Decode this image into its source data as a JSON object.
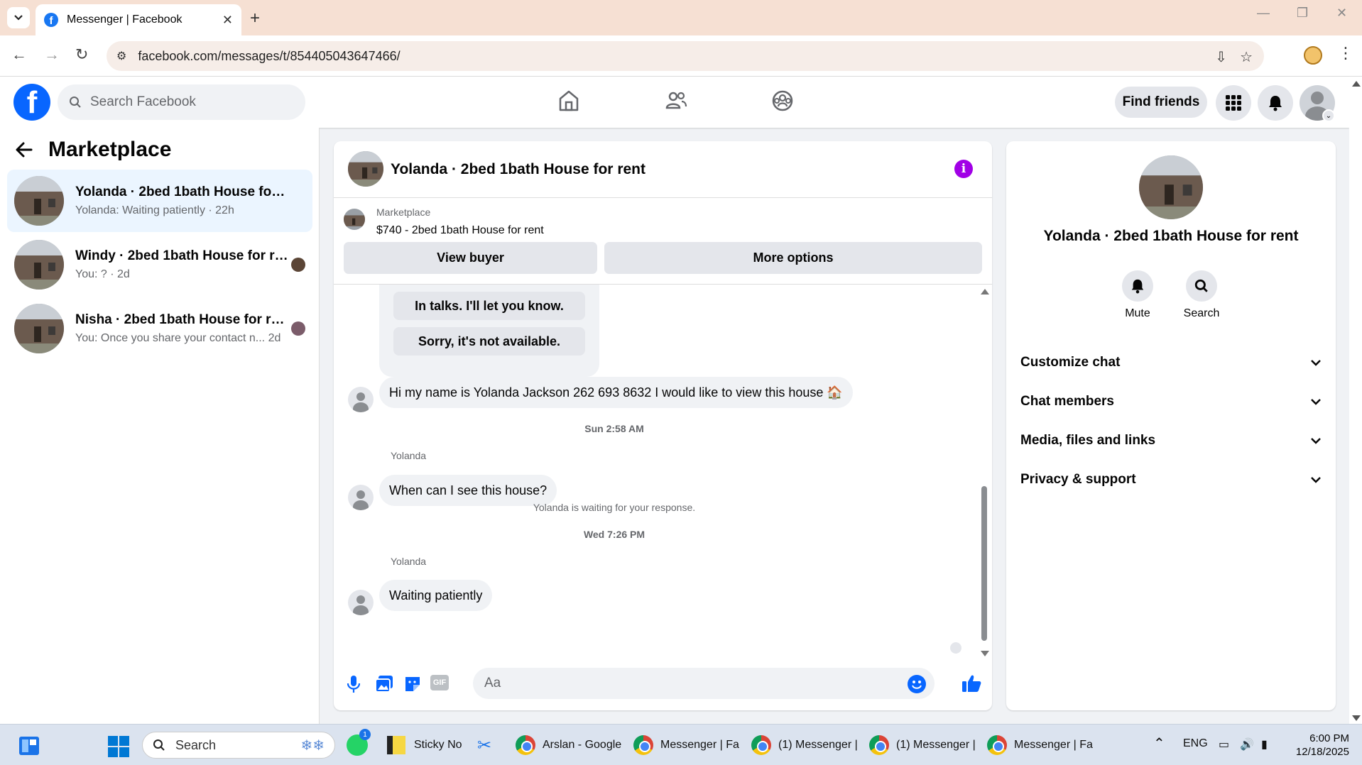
{
  "browser": {
    "tab_title": "Messenger | Facebook",
    "url": "facebook.com/messages/t/854405043647466/"
  },
  "fb": {
    "search_placeholder": "Search Facebook",
    "find_friends": "Find friends"
  },
  "sidebar": {
    "title": "Marketplace",
    "conversations": [
      {
        "name": "Yolanda · 2bed 1bath House for rent",
        "snippet": "Yolanda: Waiting patiently · 22h",
        "active": true
      },
      {
        "name": "Windy · 2bed 1bath House for re...",
        "snippet": "You: ? · 2d",
        "active": false
      },
      {
        "name": "Nisha · 2bed 1bath House for rent",
        "snippet": "You: Once you share your contact n... 2d",
        "active": false
      }
    ]
  },
  "chat": {
    "title": "Yolanda · 2bed 1bath House for rent",
    "marketplace_label": "Marketplace",
    "listing": "$740 - 2bed 1bath House for rent",
    "view_buyer": "View buyer",
    "more_options": "More options",
    "quick_replies": [
      "In talks. I'll let you know.",
      "Sorry, it's not available."
    ],
    "message1": "Hi my name is Yolanda Jackson 262 693 8632  I would like to view this house 🏠",
    "time1": "Sun 2:58 AM",
    "sender2": "Yolanda",
    "message2": "When can I see this house?",
    "waiting_notice": "Yolanda is waiting for your response.",
    "time2": "Wed 7:26 PM",
    "sender3": "Yolanda",
    "message3": "Waiting  patiently",
    "composer_placeholder": "Aa",
    "gif_label": "GIF"
  },
  "details": {
    "name": "Yolanda · 2bed 1bath House for rent",
    "mute": "Mute",
    "search": "Search",
    "sections": [
      "Customize chat",
      "Chat members",
      "Media, files and links",
      "Privacy & support"
    ]
  },
  "taskbar": {
    "search": "Search",
    "items": [
      "Sticky No",
      "Arslan - Google",
      "Messenger | Fa",
      "(1) Messenger |",
      "(1) Messenger |",
      "Messenger | Fa"
    ],
    "whatsapp_badge": "1",
    "lang": "ENG",
    "time": "6:00 PM",
    "date": "12/18/2025"
  },
  "colors": {
    "fb_blue": "#0866ff",
    "info_purple": "#a100e6",
    "active_row": "#ebf5ff"
  }
}
